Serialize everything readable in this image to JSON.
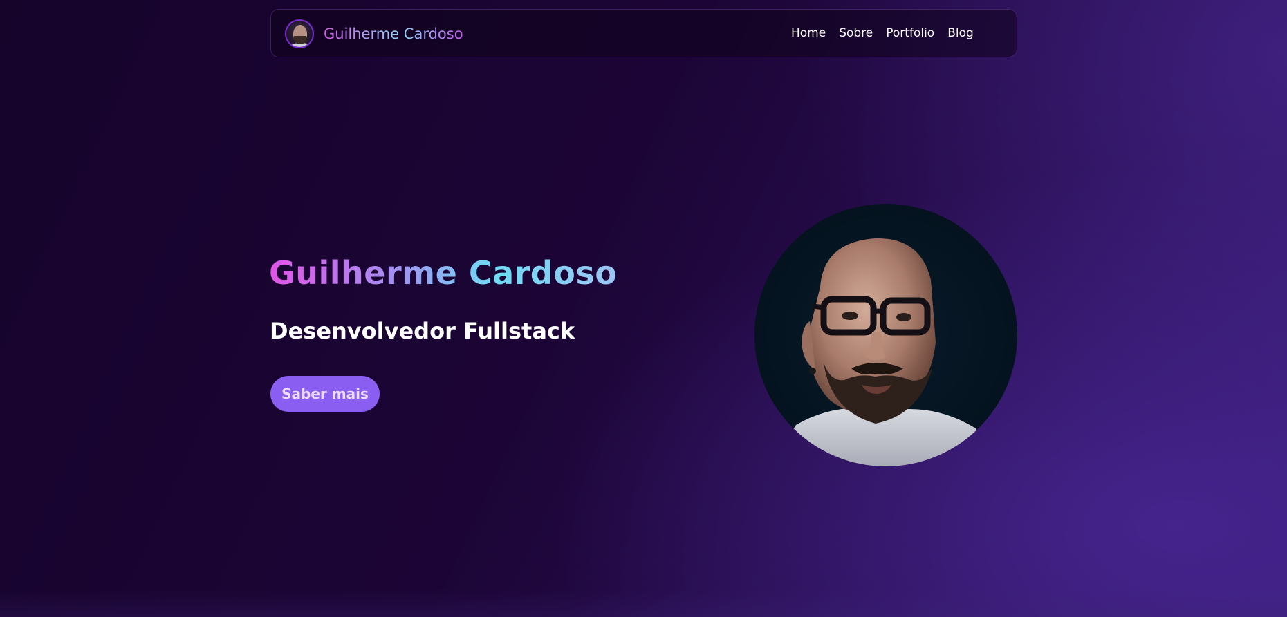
{
  "header": {
    "brand_name": "Guilherme Cardoso",
    "nav": [
      {
        "label": "Home"
      },
      {
        "label": "Sobre"
      },
      {
        "label": "Portfolio"
      },
      {
        "label": "Blog"
      }
    ]
  },
  "hero": {
    "title": "Guilherme Cardoso",
    "subtitle": "Desenvolvedor Fullstack",
    "cta_label": "Saber mais"
  },
  "colors": {
    "accent_button": "#8a5ef0",
    "gradient_pink": "#e254e6",
    "gradient_cyan": "#6fdcf4",
    "background_dark": "#1c0536"
  }
}
